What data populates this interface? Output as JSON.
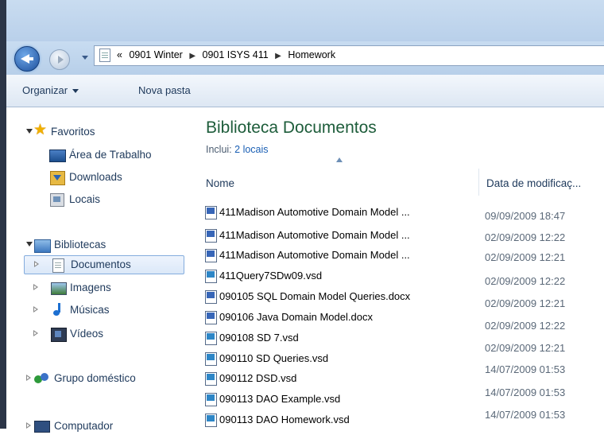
{
  "address": {
    "overflow_marker": "«",
    "crumbs": [
      "0901 Winter",
      "0901 ISYS 411",
      "Homework"
    ]
  },
  "toolbar": {
    "organize_label": "Organizar",
    "new_folder_label": "Nova pasta"
  },
  "sidebar": {
    "favorites": {
      "label": "Favoritos",
      "items": [
        "Área de Trabalho",
        "Downloads",
        "Locais"
      ]
    },
    "libraries": {
      "label": "Bibliotecas",
      "items": [
        "Documentos",
        "Imagens",
        "Músicas",
        "Vídeos"
      ],
      "selected": "Documentos"
    },
    "homegroup": {
      "label": "Grupo doméstico"
    },
    "computer": {
      "label": "Computador"
    }
  },
  "library": {
    "title": "Biblioteca Documentos",
    "includes_prefix": "Inclui:",
    "includes_link": "2 locais"
  },
  "columns": {
    "name": "Nome",
    "date": "Data de modificaç..."
  },
  "files": [
    {
      "name": "411Madison Automotive Domain Model ...",
      "type": "word",
      "date": "09/09/2009 18:47"
    },
    {
      "name": "411Madison Automotive Domain Model ...",
      "type": "word",
      "date": "02/09/2009 12:22"
    },
    {
      "name": "411Madison Automotive Domain Model ...",
      "type": "word",
      "date": "02/09/2009 12:21"
    },
    {
      "name": "411Query7SDw09.vsd",
      "type": "visio",
      "date": "02/09/2009 12:22"
    },
    {
      "name": "090105 SQL Domain Model Queries.docx",
      "type": "word",
      "date": "02/09/2009 12:21"
    },
    {
      "name": "090106 Java Domain Model.docx",
      "type": "word",
      "date": "02/09/2009 12:22"
    },
    {
      "name": "090108 SD 7.vsd",
      "type": "visio",
      "date": "02/09/2009 12:21"
    },
    {
      "name": "090110 SD Queries.vsd",
      "type": "visio",
      "date": "14/07/2009 01:53"
    },
    {
      "name": "090112 DSD.vsd",
      "type": "visio",
      "date": "14/07/2009 01:53"
    },
    {
      "name": "090113 DAO Example.vsd",
      "type": "visio",
      "date": "14/07/2009 01:53"
    },
    {
      "name": "090113 DAO Homework.vsd",
      "type": "visio",
      "date": ""
    }
  ]
}
